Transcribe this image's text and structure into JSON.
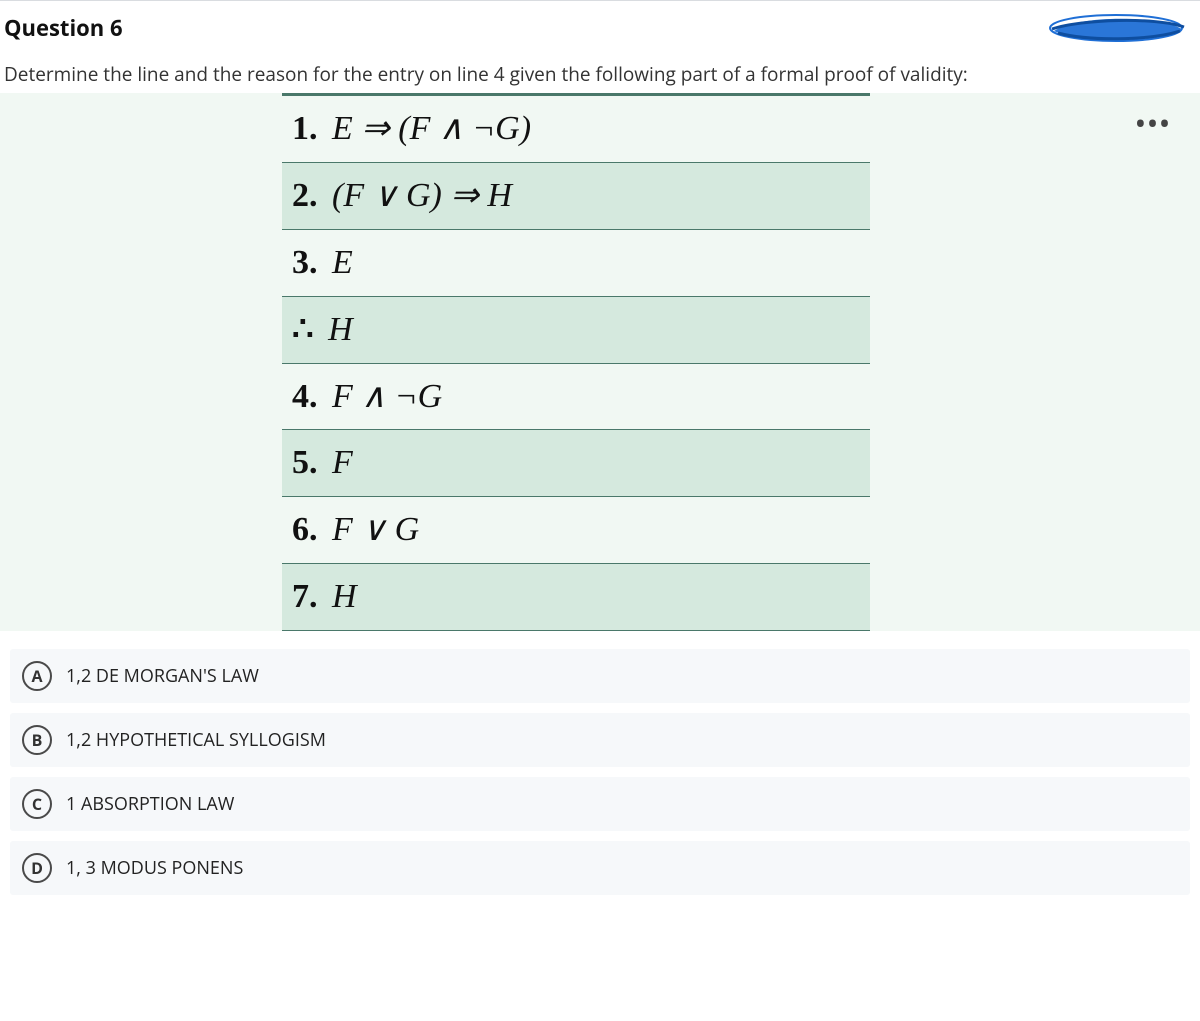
{
  "question": {
    "number_label": "Question 6",
    "prompt": "Determine the line and the reason for the entry on line 4 given the following part of a formal proof of validity:"
  },
  "proof": {
    "lines": [
      {
        "num": "1.",
        "expr": "E  ⇒  (F ∧ ¬G)"
      },
      {
        "num": "2.",
        "expr": "(F ∨ G)  ⇒  H"
      },
      {
        "num": "3.",
        "expr": "E"
      },
      {
        "num": "∴",
        "expr": "H"
      },
      {
        "num": "4.",
        "expr": "F ∧ ¬G"
      },
      {
        "num": "5.",
        "expr": " F"
      },
      {
        "num": "6.",
        "expr": " F ∨ G"
      },
      {
        "num": "7.",
        "expr": "H"
      }
    ]
  },
  "menu": {
    "dots": "•••"
  },
  "options": [
    {
      "letter": "A",
      "text": "1,2 DE MORGAN'S LAW"
    },
    {
      "letter": "B",
      "text": "1,2 HYPOTHETICAL SYLLOGISM"
    },
    {
      "letter": "C",
      "text": "1 ABSORPTION LAW"
    },
    {
      "letter": "D",
      "text": "1, 3 MODUS PONENS"
    }
  ]
}
